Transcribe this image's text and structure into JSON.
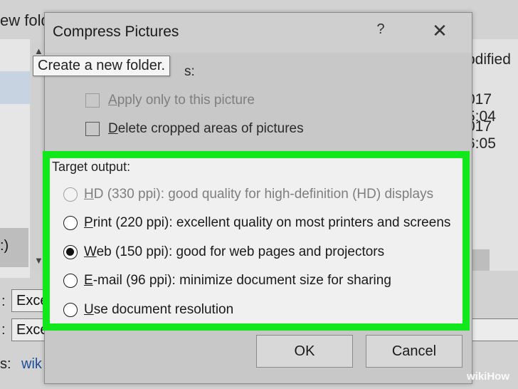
{
  "background": {
    "window_title_fragment": "ew fold",
    "right_column_header": "odified",
    "right_column_values": [
      "017 5:04",
      "017 6:05"
    ],
    "left_panel_fragment": ":)",
    "field1_label": ":",
    "field1_value": "Exce",
    "field2_label": ":",
    "field2_value": "Exce",
    "field3_label": "s:",
    "field3_link": "wik"
  },
  "tooltip": {
    "text": "Create a new folder."
  },
  "dialog": {
    "title": "Compress Pictures",
    "help_label": "?",
    "close_label": "✕",
    "section_fragment": "s:",
    "options": [
      {
        "label": "Apply only to this picture",
        "checked": false,
        "disabled": true
      },
      {
        "label": "Delete cropped areas of pictures",
        "checked": false,
        "disabled": false
      }
    ],
    "target_output_label": "Target output:",
    "resolutions": [
      {
        "key": "H",
        "rest": "D (330 ppi): good quality for high-definition (HD) displays",
        "selected": false,
        "disabled": true
      },
      {
        "key": "P",
        "rest": "rint (220 ppi): excellent quality on most printers and screens",
        "selected": false,
        "disabled": false
      },
      {
        "key": "W",
        "rest": "eb (150 ppi): good for web pages and projectors",
        "selected": true,
        "disabled": false
      },
      {
        "key": "E",
        "rest": "-mail (96 ppi): minimize document size for sharing",
        "selected": false,
        "disabled": false
      },
      {
        "key": "U",
        "rest": "se document resolution",
        "selected": false,
        "disabled": false
      }
    ],
    "ok_label": "OK",
    "cancel_label": "Cancel"
  },
  "watermark": "wikiHow",
  "colors": {
    "highlight": "#11e81b",
    "dialog_bg": "#c8c8c8",
    "panel_bg": "#f0f0f0"
  }
}
